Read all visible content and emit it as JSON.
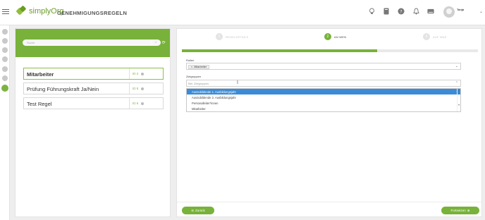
{
  "app": {
    "logo_text": "simplyOrg",
    "page_title": "GENEHMIGUNGSREGELN",
    "user_name": "Tanja"
  },
  "topbar_icons": [
    "lightbulb-icon",
    "book-icon",
    "help-icon",
    "bell-icon",
    "keyboard-icon"
  ],
  "left": {
    "search_placeholder": "Suche",
    "rules": [
      {
        "name": "Mitarbeiter",
        "id": "ID 2",
        "selected": true
      },
      {
        "name": "Prüfung Führungskraft Ja/Nein",
        "id": "ID 5",
        "selected": false
      },
      {
        "name": "Test Regel",
        "id": "ID 6",
        "selected": false
      }
    ]
  },
  "wizard": {
    "steps": [
      {
        "num": "1",
        "label": "REGELDETAILS",
        "active": false
      },
      {
        "num": "2",
        "label": "AN WEN",
        "active": true
      },
      {
        "num": "3",
        "label": "AUF WAS",
        "active": false
      }
    ],
    "progress_percent": 66,
    "rollen_label": "Rollen",
    "rollen_chip": "Mitarbeiter",
    "zielgruppen_label": "Zielgruppen",
    "zielgruppen_placeholder": "Bitt. Zielgruppen",
    "options": [
      {
        "label": "Auszubildende 1. Ausbildungsjahr",
        "highlighted": true
      },
      {
        "label": "Auszubildende 2. Ausbildungsjahr",
        "highlighted": false
      },
      {
        "label": "Personalleiter*innen",
        "highlighted": false
      },
      {
        "label": "Mitarbeiter",
        "highlighted": false
      }
    ],
    "back_label": "Zurück",
    "next_label": "Fortsetzen"
  },
  "colors": {
    "accent": "#78b23a",
    "highlight": "#3b8bd6"
  }
}
